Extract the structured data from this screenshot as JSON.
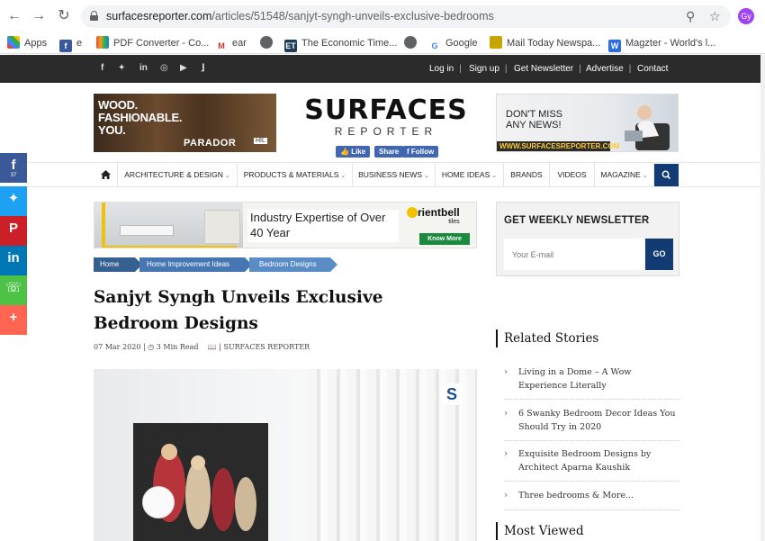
{
  "browser": {
    "url_host": "surfacesreporter.com",
    "url_path": "/articles/51548/sanjyt-syngh-unveils-exclusive-bedrooms",
    "profile_initials": "Gy",
    "bookmarks": [
      {
        "label": "Apps",
        "icon": "apps-grid-icon",
        "color": "#e8453c"
      },
      {
        "label": "e",
        "icon": "facebook-icon",
        "color": "#3b5998"
      },
      {
        "label": "PDF Converter - Co...",
        "icon": "pdf-converter-icon",
        "color": "#e74c3c"
      },
      {
        "label": "ear",
        "icon": "gmail-icon",
        "color": "#d93025"
      },
      {
        "label": "",
        "icon": "globe-icon",
        "color": "#5f6368"
      },
      {
        "label": "The Economic Time...",
        "icon": "economic-times-icon",
        "color": "#1e3d59"
      },
      {
        "label": "",
        "icon": "globe-icon",
        "color": "#5f6368"
      },
      {
        "label": "Google",
        "icon": "google-icon",
        "color": "#4285f4"
      },
      {
        "label": "Mail Today Newspa...",
        "icon": "mail-today-icon",
        "color": "#c8a400"
      },
      {
        "label": "Magzter - World's l...",
        "icon": "magzter-icon",
        "color": "#2d6cdf"
      }
    ]
  },
  "topbar": {
    "social": [
      "facebook-icon",
      "twitter-icon",
      "linkedin-icon",
      "instagram-icon",
      "youtube-icon",
      "rss-icon"
    ],
    "links": [
      "Log in",
      "Sign up",
      "Get Newsletter",
      "Advertise",
      "Contact"
    ]
  },
  "header": {
    "ad_left": {
      "line1": "WOOD.",
      "line2": "FASHIONABLE.",
      "line3": "YOU.",
      "brand": "PARADOR",
      "tag": "HIL"
    },
    "logo_main": "SURFACES",
    "logo_sub": "REPORTER",
    "fb_like": "Like",
    "fb_share": "Share",
    "fb_follow": "Follow",
    "ad_right": {
      "line1": "DON'T MISS",
      "line2": "ANY NEWS!",
      "url": "WWW.SURFACESREPORTER.COM"
    }
  },
  "nav": {
    "items": [
      {
        "label": "ARCHITECTURE & DESIGN",
        "dropdown": true
      },
      {
        "label": "PRODUCTS & MATERIALS",
        "dropdown": true
      },
      {
        "label": "BUSINESS NEWS",
        "dropdown": true
      },
      {
        "label": "HOME IDEAS",
        "dropdown": true
      },
      {
        "label": "BRANDS",
        "dropdown": false
      },
      {
        "label": "VIDEOS",
        "dropdown": false
      },
      {
        "label": "MAGAZINE",
        "dropdown": true
      }
    ]
  },
  "share_rail": {
    "facebook_count": "37",
    "items": [
      {
        "icon": "facebook-icon",
        "color": "#3b5998"
      },
      {
        "icon": "twitter-icon",
        "color": "#1da1f2"
      },
      {
        "icon": "pinterest-icon",
        "color": "#cb2027"
      },
      {
        "icon": "linkedin-icon",
        "color": "#0077b5"
      },
      {
        "icon": "whatsapp-icon",
        "color": "#4dc247"
      },
      {
        "icon": "plus-icon",
        "color": "#ff6550"
      }
    ]
  },
  "banner": {
    "text": "Industry Expertise of Over 40 Year",
    "brand": "rientbell",
    "brand_sub": "tiles",
    "cta": "Know More"
  },
  "breadcrumbs": [
    "Home",
    "Home Improvement Ideas",
    "Bedroom Designs"
  ],
  "article": {
    "title": "Sanjyt Syngh Unveils Exclusive Bedroom Designs",
    "date": "07 Mar 2020",
    "read_time": "3 Min Read",
    "source": "SURFACES REPORTER"
  },
  "sidebar": {
    "newsletter_heading": "GET WEEKLY NEWSLETTER",
    "email_placeholder": "Your E-mail",
    "go_label": "GO",
    "related_heading": "Related Stories",
    "related": [
      "Living in a Dome – A Wow Experience Literally",
      "6 Swanky Bedroom Decor Ideas You Should Try in 2020",
      "Exquisite Bedroom Designs by Architect Aparna Kaushik",
      "Three bedrooms & More..."
    ],
    "most_viewed_heading": "Most Viewed"
  },
  "colors": {
    "navy": "#123b74",
    "topbar": "#2b2b2b",
    "breadcrumb": "#3b6aa8"
  }
}
